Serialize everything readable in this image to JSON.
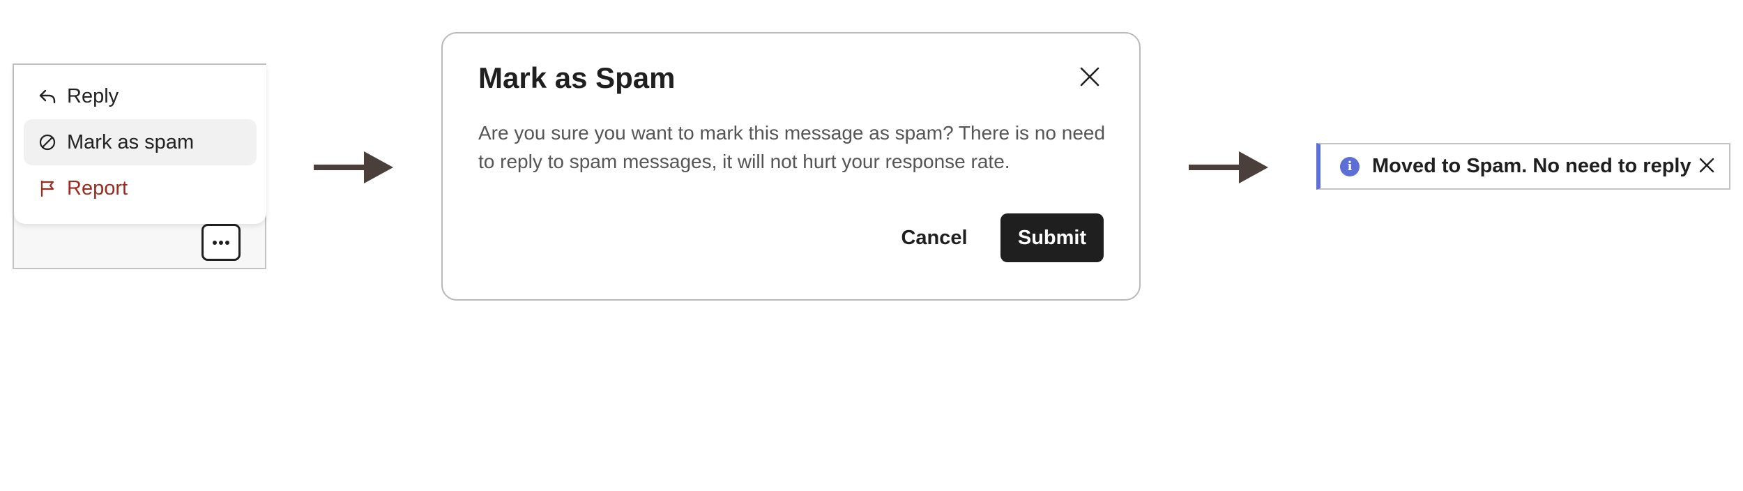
{
  "context_menu": {
    "items": [
      {
        "label": "Reply",
        "icon": "reply-icon"
      },
      {
        "label": "Mark as spam",
        "icon": "block-icon",
        "highlighted": true
      },
      {
        "label": "Report",
        "icon": "flag-icon",
        "danger_color": "#9e2a1e"
      }
    ],
    "more_button_icon": "more-horizontal-icon"
  },
  "modal": {
    "title": "Mark as Spam",
    "body": "Are you sure you want to mark this message as spam? There is no need to reply to spam messages, it will not hurt your response rate.",
    "cancel_label": "Cancel",
    "submit_label": "Submit",
    "close_icon": "close-icon"
  },
  "toast": {
    "icon": "info-icon",
    "icon_glyph": "i",
    "message": "Moved to Spam. No need to reply",
    "close_icon": "close-icon",
    "accent_color": "#5b6fd6"
  },
  "colors": {
    "arrow": "#4a3f3a",
    "primary_button": "#1f1f1f"
  }
}
